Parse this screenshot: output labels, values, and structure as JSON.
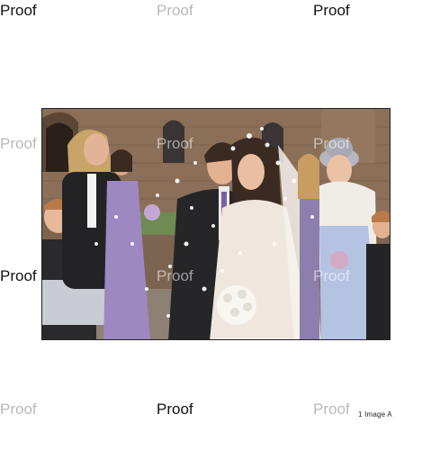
{
  "watermark": {
    "text": "Proof"
  },
  "photo": {
    "subject": "wedding couple kissing under confetti outside church",
    "colors": {
      "stone": "#8a6f57",
      "suit": "#2a2a2c",
      "dress": "#efe8df",
      "lilac": "#a591c8",
      "sky_dress": "#b7c6e3"
    }
  },
  "caption": {
    "text": "1 Image A"
  }
}
